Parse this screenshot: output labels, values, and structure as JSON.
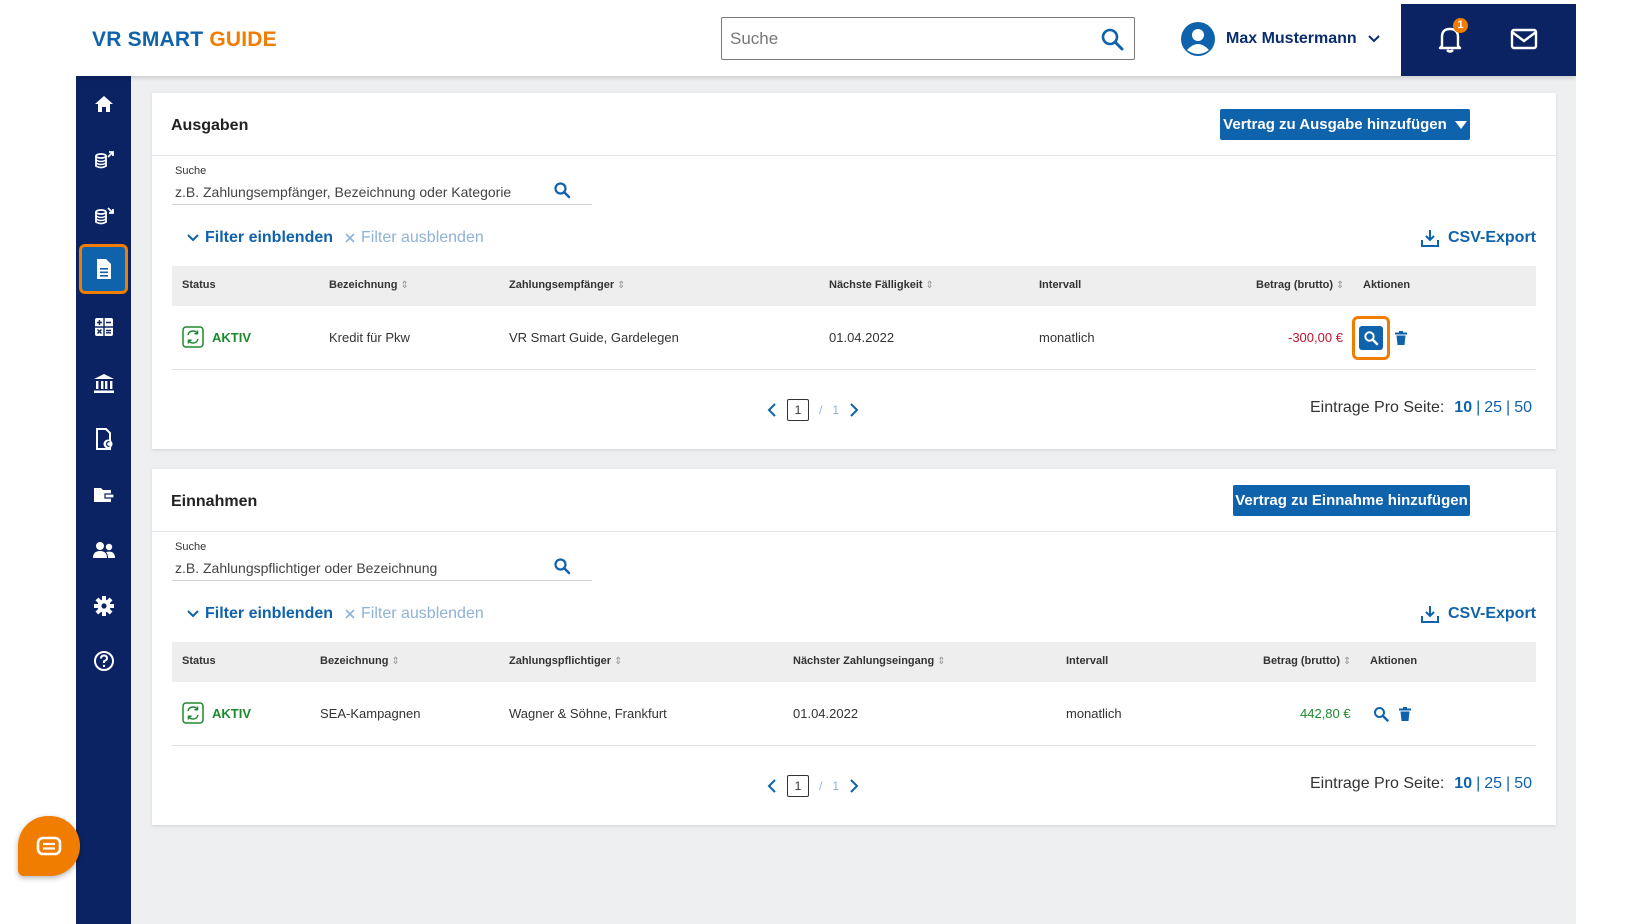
{
  "header": {
    "logo_part1": "VR SMART",
    "logo_part2": "GUIDE",
    "search_placeholder": "Suche",
    "user_name": "Max Mustermann",
    "notification_count": "1"
  },
  "sidebar": {
    "items": [
      {
        "icon": "home-icon"
      },
      {
        "icon": "expenses-icon"
      },
      {
        "icon": "income-icon"
      },
      {
        "icon": "contracts-icon",
        "active": true
      },
      {
        "icon": "calculator-icon"
      },
      {
        "icon": "bank-icon"
      },
      {
        "icon": "invoice-icon"
      },
      {
        "icon": "folder-icon"
      },
      {
        "icon": "users-icon"
      },
      {
        "icon": "settings-icon"
      },
      {
        "icon": "help-icon"
      }
    ]
  },
  "ausgaben": {
    "title": "Ausgaben",
    "add_button": "Vertrag zu Ausgabe hinzufügen",
    "search_label": "Suche",
    "search_placeholder": "z.B. Zahlungsempfänger, Bezeichnung oder Kategorie",
    "filter_show": "Filter einblenden",
    "filter_hide": "Filter ausblenden",
    "csv_export": "CSV-Export",
    "columns": [
      "Status",
      "Bezeichnung",
      "Zahlungsempfänger",
      "Nächste Fälligkeit",
      "Intervall",
      "Betrag (brutto)",
      "Aktionen"
    ],
    "rows": [
      {
        "status": "AKTIV",
        "bezeichnung": "Kredit für Pkw",
        "empfaenger": "VR Smart Guide, Gardelegen",
        "faelligkeit": "01.04.2022",
        "intervall": "monatlich",
        "betrag": "-300,00 €"
      }
    ],
    "pager": {
      "current": "1",
      "separator": "/",
      "total": "1"
    },
    "per_page": {
      "label": "Eintrage Pro Seite:",
      "options": [
        "10",
        "25",
        "50"
      ],
      "sep": "|"
    }
  },
  "einnahmen": {
    "title": "Einnahmen",
    "add_button": "Vertrag zu Einnahme hinzufügen",
    "search_label": "Suche",
    "search_placeholder": "z.B. Zahlungspflichtiger oder Bezeichnung",
    "filter_show": "Filter einblenden",
    "filter_hide": "Filter ausblenden",
    "csv_export": "CSV-Export",
    "columns": [
      "Status",
      "Bezeichnung",
      "Zahlungspflichtiger",
      "Nächster Zahlungseingang",
      "Intervall",
      "Betrag (brutto)",
      "Aktionen"
    ],
    "rows": [
      {
        "status": "AKTIV",
        "bezeichnung": "SEA-Kampagnen",
        "pflichtiger": "Wagner & Söhne, Frankfurt",
        "eingang": "01.04.2022",
        "intervall": "monatlich",
        "betrag": "442,80 €"
      }
    ],
    "pager": {
      "current": "1",
      "separator": "/",
      "total": "1"
    },
    "per_page": {
      "label": "Eintrage Pro Seite:",
      "options": [
        "10",
        "25",
        "50"
      ],
      "sep": "|"
    }
  },
  "colors": {
    "brand_blue": "#0f62ac",
    "brand_orange": "#f07d00",
    "navy": "#0b2363",
    "active_green": "#1e8a2e",
    "negative_red": "#c0152e",
    "positive_green": "#1e8a2e"
  }
}
